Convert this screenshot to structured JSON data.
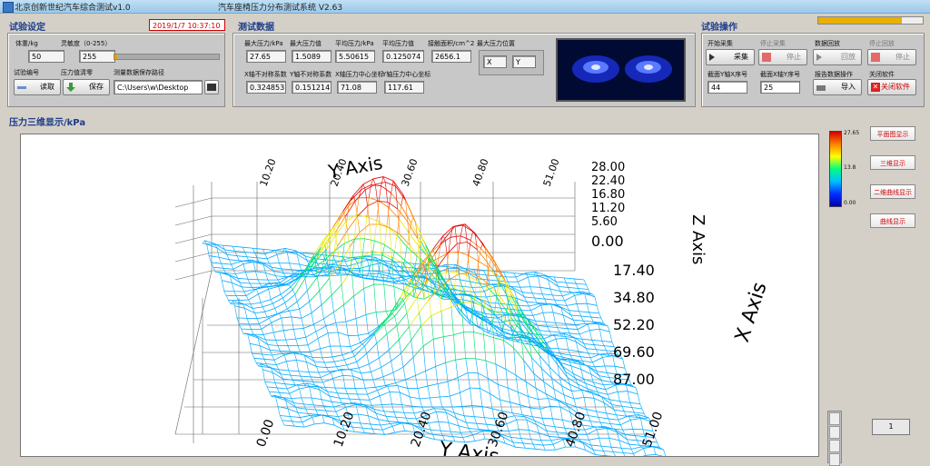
{
  "window": {
    "title_left": "北京创新世纪汽车综合测试v1.0",
    "title_center": "汽车座椅压力分布测试系统 V2.63"
  },
  "status": {
    "datetime": "2019/1/7  10:37:10",
    "progress": 0.8
  },
  "setup": {
    "title": "试验设定",
    "weight_label": "体重/kg",
    "weight_value": "50",
    "sensitivity_label": "灵敏度（0-255）",
    "sensitivity_value": "255",
    "test_id_label": "试验编号",
    "zero_label": "压力值清零",
    "save_path_label": "测量数据保存路径",
    "read_btn": "读取",
    "save_btn": "保存",
    "path_value": "C:\\Users\\w\\Desktop"
  },
  "measure": {
    "title": "测试数据",
    "items": [
      {
        "label": "最大压力/kPa",
        "value": "27.65"
      },
      {
        "label": "最大压力值",
        "value": "1.5089"
      },
      {
        "label": "平均压力/kPa",
        "value": "5.50615"
      },
      {
        "label": "平均压力值",
        "value": "0.125074"
      },
      {
        "label": "接触面积/cm^2",
        "value": "2656.1"
      },
      {
        "label": "最大压力位置",
        "value": ""
      },
      {
        "label": "X轴不对称系数",
        "value": "0.324853"
      },
      {
        "label": "Y轴不对称系数",
        "value": "0.151214"
      },
      {
        "label": "X轴压力中心坐标",
        "value": "71.08"
      },
      {
        "label": "Y轴压力中心坐标",
        "value": "117.61"
      }
    ],
    "x_box": "X",
    "y_box": "Y"
  },
  "ops": {
    "title": "试验操作",
    "start_label": "开始采集",
    "start_btn": "采集",
    "stop_label": "停止采集",
    "stop_btn": "停止",
    "replay_label": "数据回放",
    "replay_btn": "回放",
    "stop_replay_label": "停止回放",
    "stop_replay_btn": "停止",
    "x_count_label": "截面Y轴X序号",
    "x_count_value": "44",
    "y_count_label": "截面X轴Y序号",
    "y_count_value": "25",
    "report_label": "报告数据操作",
    "report_btn": "导入",
    "close_label": "关闭软件",
    "close_btn": "关闭软件"
  },
  "plot": {
    "section_title": "压力三维显示/kPa",
    "z_ticks": [
      "28.00",
      "22.40",
      "16.80",
      "11.20",
      "5.60",
      "0.00"
    ],
    "x_ticks": [
      "17.40",
      "34.80",
      "52.20",
      "69.60",
      "87.00"
    ],
    "y_ticks_front": [
      "0.00",
      "10.20",
      "20.40",
      "30.60",
      "40.80",
      "51.00"
    ],
    "y_ticks_back": [
      "10.20",
      "20.40",
      "30.60",
      "40.80",
      "51.00"
    ],
    "z_axis": "Z Axis",
    "x_axis": "X Axis",
    "y_axis": "Y Axis"
  },
  "legend": {
    "max": "27.65",
    "mid": "13.8",
    "min": "0.00"
  },
  "right_buttons": [
    "平面图显示",
    "三维显示",
    "二维曲线显示",
    "曲线显示"
  ],
  "corner_value": "1",
  "colors": {
    "accent": "#1c3d8a",
    "panel_bg": "#d4d0c8",
    "danger": "#cc0000"
  }
}
